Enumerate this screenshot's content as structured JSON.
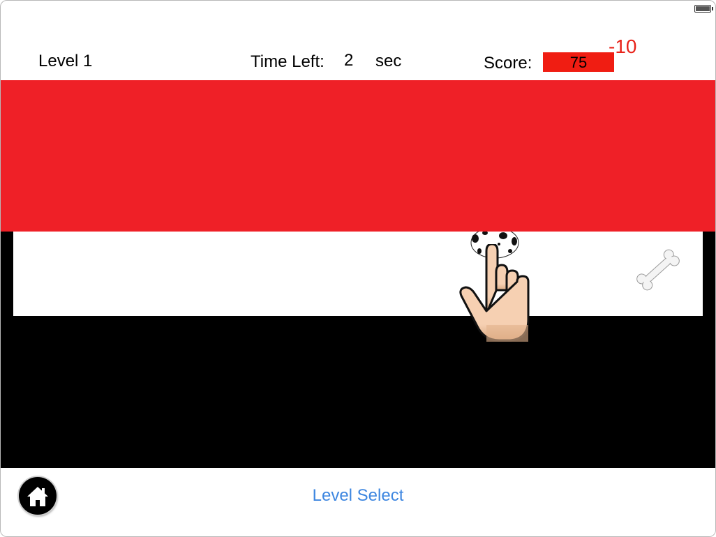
{
  "hud": {
    "level": "Level 1",
    "time_label": "Time Left:",
    "time_value": "2",
    "time_unit": "sec",
    "score_label": "Score:",
    "score_value": "75",
    "score_delta": "-10"
  },
  "nav": {
    "level_select": "Level Select"
  },
  "icons": {
    "home": "home-icon",
    "battery": "battery-icon",
    "hand": "pointing-hand-icon",
    "dog": "dalmatian-dog-icon",
    "bone": "bone-icon"
  },
  "colors": {
    "score_box": "#f01d12",
    "score_delta": "#e8231a",
    "red_band": "#ef2027",
    "link": "#3d86e0"
  }
}
